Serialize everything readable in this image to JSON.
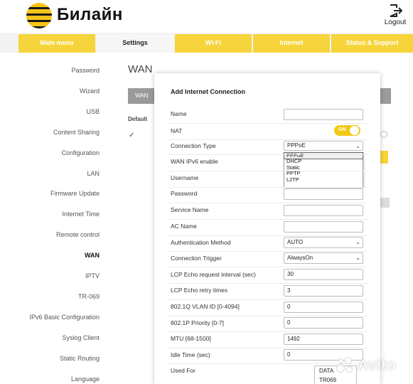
{
  "header": {
    "brand": "Билайн",
    "logout_label": "Logout"
  },
  "topnav": {
    "tabs": [
      {
        "label": "Main menu"
      },
      {
        "label": "Settings"
      },
      {
        "label": "Wi-Fi"
      },
      {
        "label": "Internet"
      },
      {
        "label": "Status & Support"
      }
    ],
    "active": "Settings"
  },
  "sidebar": {
    "items": [
      {
        "label": "Password"
      },
      {
        "label": "Wizard"
      },
      {
        "label": "USB"
      },
      {
        "label": "Content Sharing"
      },
      {
        "label": "Configuration"
      },
      {
        "label": "LAN"
      },
      {
        "label": "Firmware Update"
      },
      {
        "label": "Internet Time"
      },
      {
        "label": "Remote control"
      },
      {
        "label": "WAN"
      },
      {
        "label": "IPTV"
      },
      {
        "label": "TR-069"
      },
      {
        "label": "IPv6 Basic Configuration"
      },
      {
        "label": "Syslog Client"
      },
      {
        "label": "Static Routing"
      },
      {
        "label": "Language"
      }
    ],
    "active": "WAN"
  },
  "main": {
    "title": "WAN",
    "table_header": "WAN",
    "default_label": "Default",
    "check_mark": "✓"
  },
  "dialog": {
    "title": "Add Internet Connection",
    "fields": {
      "name": {
        "label": "Name",
        "value": ""
      },
      "nat": {
        "label": "NAT",
        "toggle": "ON"
      },
      "connection_type": {
        "label": "Connection Type",
        "value": "PPPoE"
      },
      "ipv6": {
        "label": "WAN IPv6 enable"
      },
      "username": {
        "label": "Username",
        "value": ""
      },
      "password": {
        "label": "Password",
        "value": ""
      },
      "service_name": {
        "label": "Service Name",
        "value": ""
      },
      "ac_name": {
        "label": "AC Name",
        "value": ""
      },
      "auth_method": {
        "label": "Authentication Method",
        "value": "AUTO"
      },
      "trigger": {
        "label": "Connection Trigger",
        "value": "AlwaysOn"
      },
      "lcp_interval": {
        "label": "LCP Echo request interval (sec)",
        "value": "30"
      },
      "lcp_retry": {
        "label": "LCP Echo retry times",
        "value": "3"
      },
      "vlan_id": {
        "label": "802.1Q VLAN ID [0-4094]",
        "value": "0"
      },
      "priority": {
        "label": "802.1P Priority [0-7]",
        "value": "0"
      },
      "mtu": {
        "label": "MTU [68-1500]",
        "value": "1492"
      },
      "idle": {
        "label": "Idle Time (sec)",
        "value": "0"
      },
      "used_for": {
        "label": "Used For",
        "options": [
          "DATA",
          "TR069"
        ]
      }
    },
    "dropdown_options": [
      "PPPoE",
      "DHCP",
      "Static",
      "PPTP",
      "L2TP"
    ],
    "dropdown_selected": "PPPoE"
  },
  "watermark": {
    "text": "Avito"
  },
  "colors": {
    "brand_yellow": "#f6d53c",
    "toggle_on": "#f3c814",
    "nav_bg": "#f3f3f3"
  }
}
